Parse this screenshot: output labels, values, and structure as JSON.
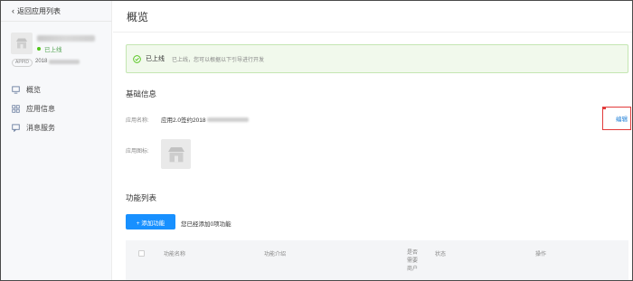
{
  "sidebar": {
    "back_label": "返回应用列表",
    "app": {
      "status": "已上线",
      "tag": "APPID",
      "id_prefix": "2018"
    },
    "nav": [
      {
        "label": "概览",
        "icon": "monitor-icon"
      },
      {
        "label": "应用信息",
        "icon": "grid-icon"
      },
      {
        "label": "消息服务",
        "icon": "message-icon"
      }
    ]
  },
  "main": {
    "title": "概览",
    "alert": {
      "title": "已上线",
      "desc": "已上线，您可以根据以下引导进行开发"
    },
    "basic": {
      "section_title": "基础信息",
      "app_name_label": "应用名称:",
      "app_name_value": "应用2.0签约2018",
      "edit_label": "编辑",
      "app_icon_label": "应用图标:"
    },
    "features": {
      "section_title": "功能列表",
      "add_button": "+ 添加功能",
      "added_text": "您已经添加0项功能",
      "columns": [
        "功能名称",
        "功能介绍",
        "是否需要商户",
        "状态",
        "操作"
      ]
    }
  },
  "colors": {
    "primary": "#1890ff",
    "success": "#52c41a",
    "highlight_border": "#e23b3b"
  }
}
